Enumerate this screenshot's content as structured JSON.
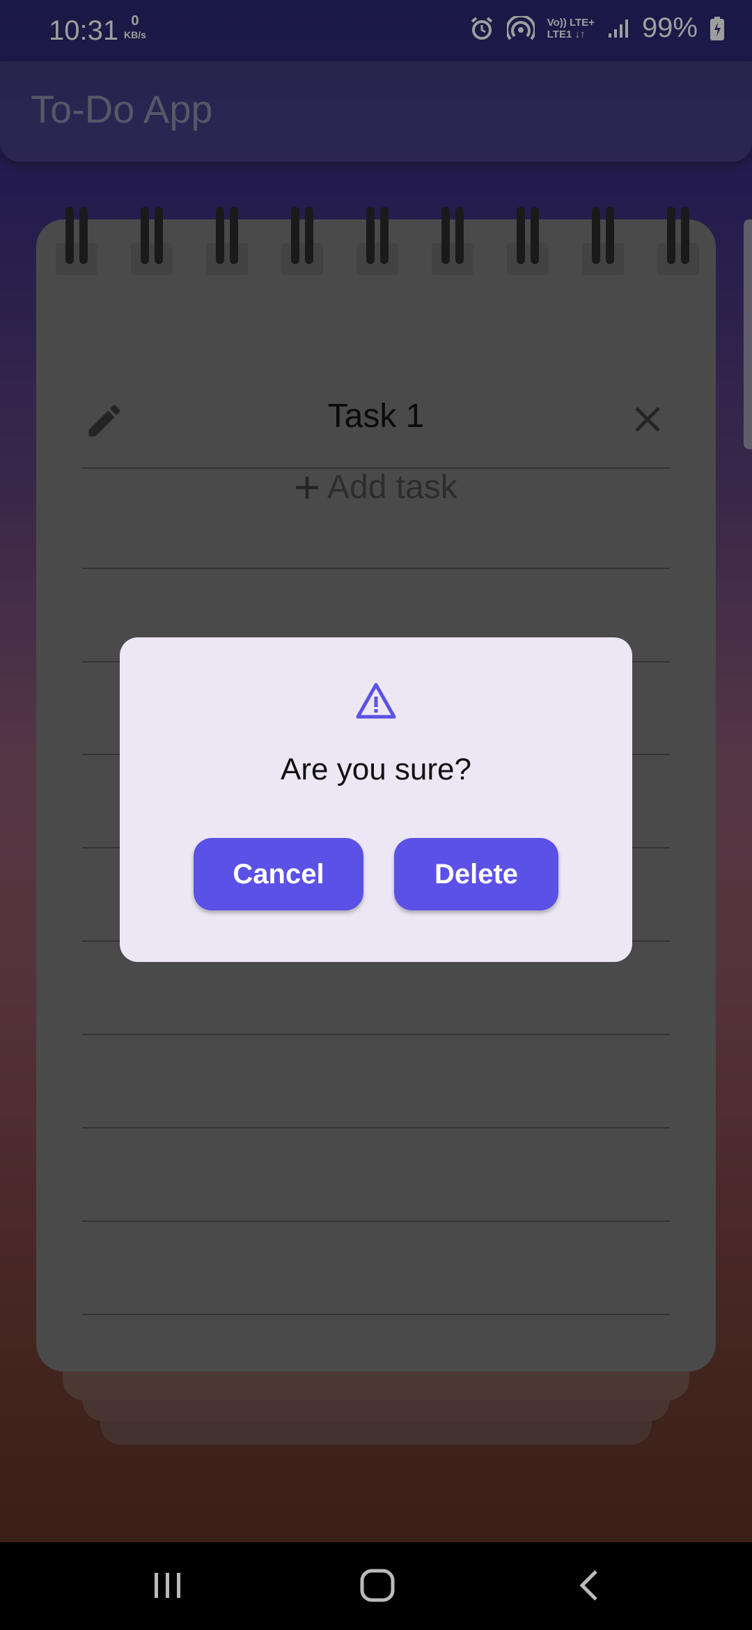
{
  "status_bar": {
    "time": "10:31",
    "net_speed": "0",
    "net_unit": "KB/s",
    "network_top": "Vo)) LTE+",
    "network_bottom": "LTE1 ↓↑",
    "battery": "99%",
    "icons": [
      "alarm-icon",
      "hotspot-icon",
      "signal-icon",
      "battery-icon"
    ]
  },
  "app_bar": {
    "title": "To-Do App"
  },
  "notepad": {
    "task_title": "Task 1",
    "add_task_label": "Add task",
    "icons": {
      "edit": "pencil-icon",
      "close": "close-icon",
      "add": "plus-icon"
    }
  },
  "dialog": {
    "icon": "warning-icon",
    "message": "Are you sure?",
    "cancel_label": "Cancel",
    "delete_label": "Delete"
  },
  "nav_bar": {
    "icons": [
      "recents-icon",
      "home-icon",
      "back-icon"
    ]
  },
  "colors": {
    "accent": "#5b51e6",
    "dialog_bg": "#ede7f5",
    "pad": "#787878"
  }
}
